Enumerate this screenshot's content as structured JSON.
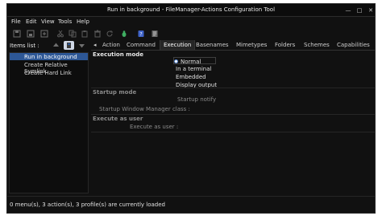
{
  "window": {
    "title": "Run in background - FileManager-Actions Configuration Tool",
    "controls": [
      "minimize-icon",
      "maximize-icon",
      "close-icon"
    ]
  },
  "menubar": [
    "File",
    "Edit",
    "View",
    "Tools",
    "Help"
  ],
  "toolbar": [
    "new-menu-icon",
    "new-action-icon",
    "new-profile-icon",
    "cut-icon",
    "copy-icon",
    "paste-icon",
    "delete-icon",
    "reload-icon",
    "bug-icon",
    "help-book-icon",
    "about-icon"
  ],
  "left_panel": {
    "label": "Items list :",
    "buttons": [
      "up-arrow-icon",
      "sort-icon",
      "down-arrow-icon"
    ],
    "items": [
      "Run in background",
      "Create Relative Symlink",
      "Create Hard Link"
    ],
    "selected_index": 0
  },
  "tabs": {
    "scroll_left": "◂",
    "items": [
      "Action",
      "Command",
      "Execution",
      "Basenames",
      "Mimetypes",
      "Folders",
      "Schemes",
      "Capabilities"
    ],
    "active": "Execution"
  },
  "execution": {
    "mode_title": "Execution mode",
    "modes": [
      "Normal",
      "In a terminal",
      "Embedded",
      "Display output"
    ],
    "selected_mode": "Normal",
    "startup_title": "Startup mode",
    "startup_notify": "Startup notify",
    "startup_wm_class": "Startup Window Manager class :",
    "execute_as_title": "Execute as user",
    "execute_as_label": "Execute as user :"
  },
  "status": "0 menu(s), 3 action(s), 3 profile(s) are currently loaded",
  "colors": {
    "selection": "#2d5796",
    "background": "#111111",
    "text": "#d8d8d8"
  }
}
